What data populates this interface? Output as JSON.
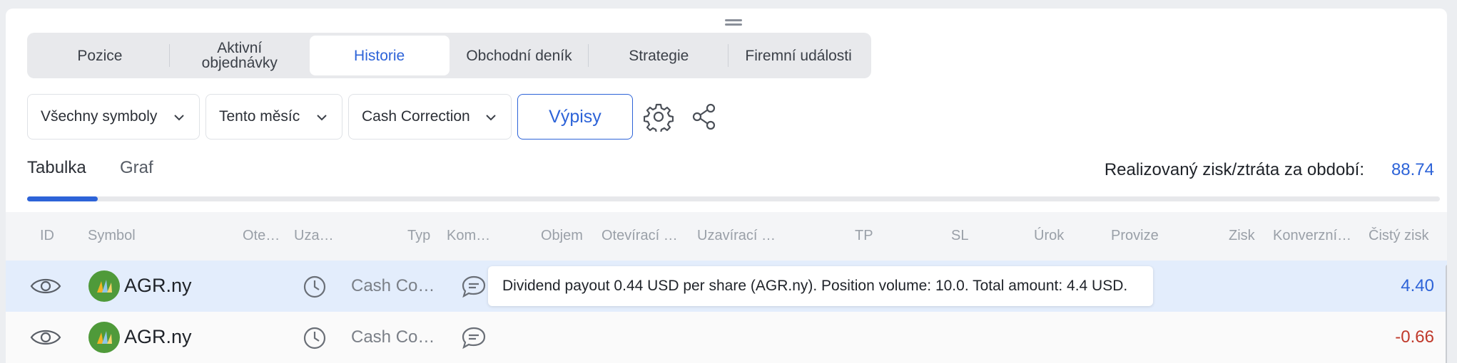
{
  "tabs": [
    {
      "label": "Pozice"
    },
    {
      "label": "Aktivní objednávky"
    },
    {
      "label": "Historie",
      "active": true
    },
    {
      "label": "Obchodní deník"
    },
    {
      "label": "Strategie"
    },
    {
      "label": "Firemní události"
    }
  ],
  "filters": {
    "symbols": "Všechny symboly",
    "period": "Tento měsíc",
    "type": "Cash Correction",
    "statements_button": "Výpisy"
  },
  "view": {
    "table_tab": "Tabulka",
    "chart_tab": "Graf",
    "active": "Tabulka",
    "pl_label": "Realizovaný zisk/ztráta za období:",
    "pl_value": "88.74",
    "scroll_progress": 0.05
  },
  "columns": [
    "ID",
    "Symbol",
    "Ote…",
    "Uza…",
    "Typ",
    "Kom…",
    "Objem",
    "Otevírací …",
    "Uzavírací …",
    "TP",
    "SL",
    "Úrok",
    "Provize",
    "Zisk",
    "Konverzní…",
    "Čistý zisk"
  ],
  "rows": [
    {
      "symbol": "AGR.ny",
      "type": "Cash Co…",
      "net_profit": "4.40",
      "highlighted": true
    },
    {
      "symbol": "AGR.ny",
      "type": "Cash Co…",
      "net_profit": "-0.66",
      "highlighted": false
    }
  ],
  "tooltip": "Dividend payout 0.44 USD per share (AGR.ny). Position volume: 10.0. Total amount: 4.4 USD.",
  "colors": {
    "accent": "#2d63d8",
    "positive": "#2d63d8",
    "negative": "#c0392b",
    "row_highlight": "#e3edfc",
    "logo_bg": "#4f9a3a"
  },
  "icons": [
    "drag-handle-icon",
    "chevron-down-icon",
    "gear-icon",
    "share-icon",
    "eye-icon",
    "clock-icon",
    "comment-icon"
  ]
}
